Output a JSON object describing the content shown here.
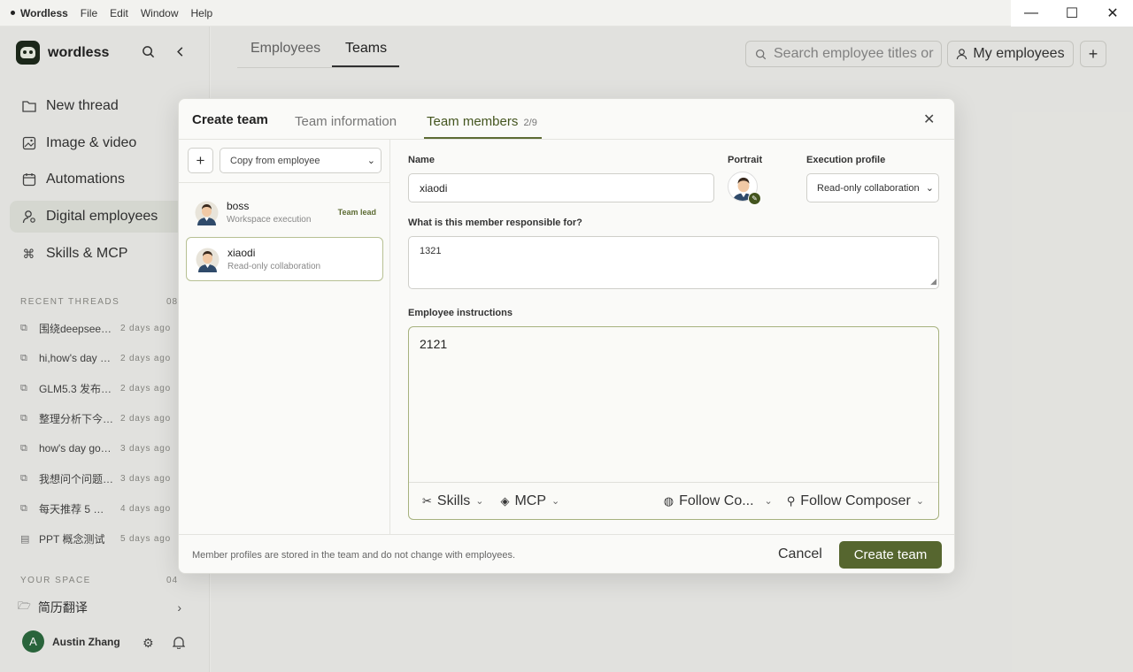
{
  "window": {
    "app_name": "Wordless",
    "menus": [
      "File",
      "Edit",
      "Window",
      "Help"
    ],
    "controls": {
      "minimize": "—",
      "maximize": "☐",
      "close": "✕"
    }
  },
  "sidebar": {
    "brand": "wordless",
    "nav": [
      {
        "label": "New thread",
        "icon": "folder-icon"
      },
      {
        "label": "Image & video",
        "icon": "image-icon"
      },
      {
        "label": "Automations",
        "icon": "calendar-icon"
      },
      {
        "label": "Digital employees",
        "icon": "person-icon"
      },
      {
        "label": "Skills & MCP",
        "icon": "command-icon"
      }
    ],
    "recent_label": "RECENT THREADS",
    "recent_count": "08",
    "threads": [
      {
        "name": "围绕deepseek…",
        "time": "2 days ago"
      },
      {
        "name": "hi,how's day go…",
        "time": "2 days ago"
      },
      {
        "name": "GLM5.3 发布…",
        "time": "2 days ago"
      },
      {
        "name": "整理分析下今…",
        "time": "2 days ago"
      },
      {
        "name": "how's day goi…",
        "time": "3 days ago"
      },
      {
        "name": "我想问个问题…",
        "time": "3 days ago"
      },
      {
        "name": "每天推荐 5 个…",
        "time": "4 days ago"
      },
      {
        "name": "PPT 概念测试",
        "time": "5 days ago"
      }
    ],
    "space_label": "YOUR SPACE",
    "space_count": "04",
    "space_item": "简历翻译",
    "user": {
      "initial": "A",
      "name": "Austin Zhang"
    }
  },
  "main": {
    "tabs": [
      "Employees",
      "Teams"
    ],
    "search_placeholder": "Search employee titles or",
    "my_employees": "My employees",
    "add": "+"
  },
  "modal": {
    "title": "Create team",
    "tab_info": "Team information",
    "tab_members": "Team members",
    "members_count": "2/9",
    "add": "+",
    "copy_select": "Copy from employee",
    "members": [
      {
        "name": "boss",
        "role": "Workspace execution",
        "badge": "Team lead"
      },
      {
        "name": "xiaodi",
        "role": "Read-only collaboration"
      }
    ],
    "form": {
      "name_label": "Name",
      "name_value": "xiaodi",
      "portrait_label": "Portrait",
      "exec_label": "Execution profile",
      "exec_value": "Read-only collaboration",
      "resp_label": "What is this member responsible for?",
      "resp_value": "1321",
      "instr_label": "Employee instructions",
      "instr_value": "2121",
      "toolbar": {
        "skills": "Skills",
        "mcp": "MCP",
        "follow_short": "Follow Co...",
        "follow_composer": "Follow Composer"
      }
    },
    "footer_note": "Member profiles are stored in the team and do not change with employees.",
    "cancel": "Cancel",
    "create": "Create team"
  }
}
